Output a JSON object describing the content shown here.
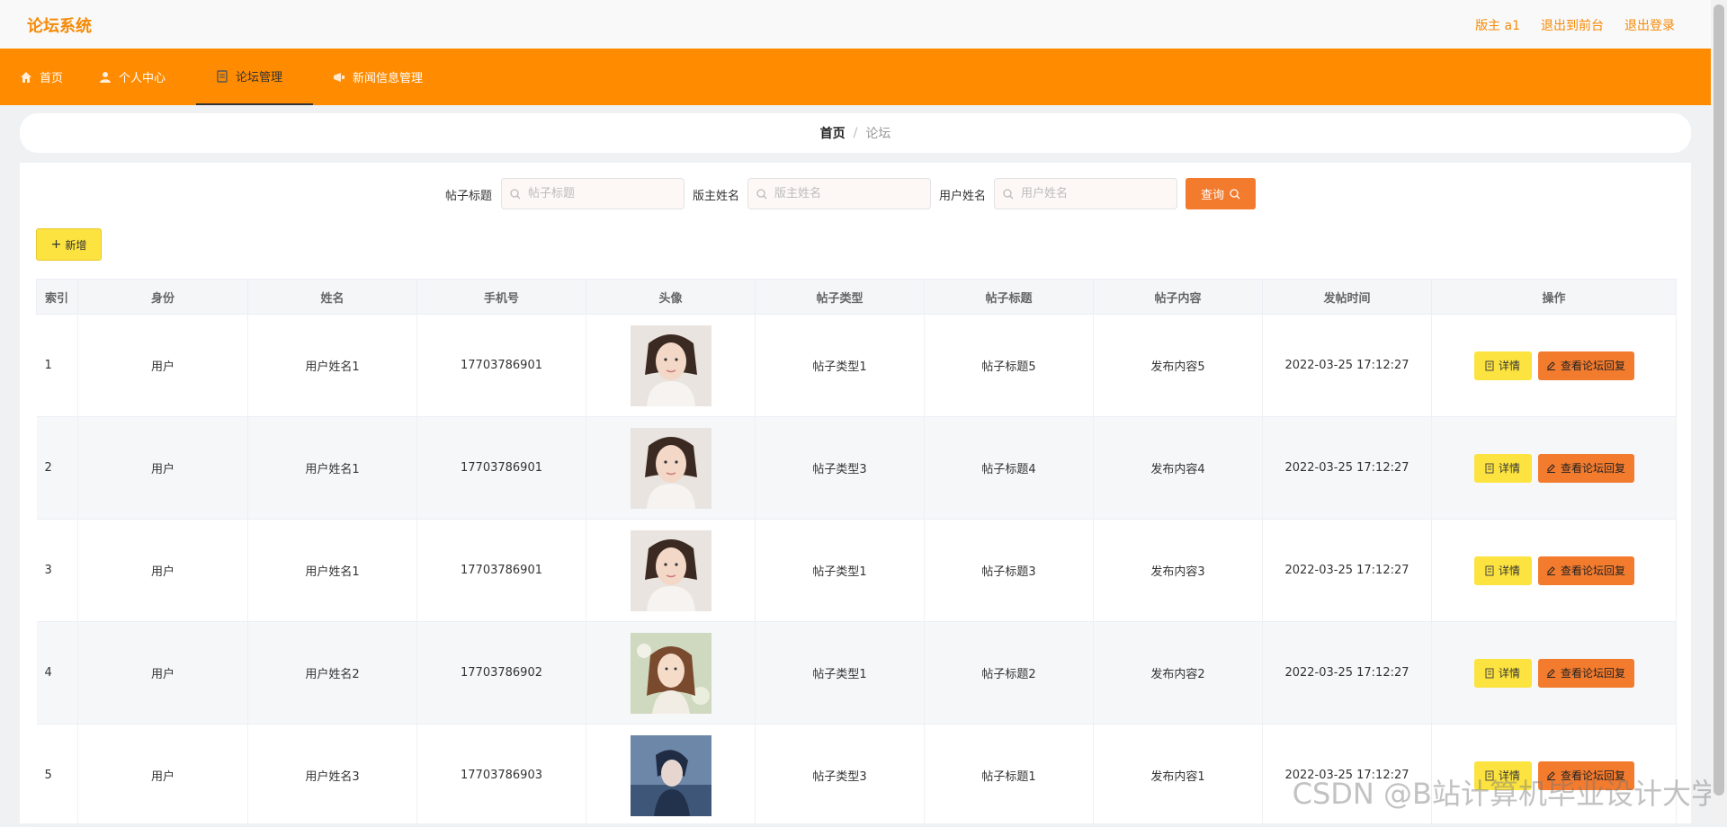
{
  "app": {
    "title": "论坛系统"
  },
  "top_links": {
    "role": "版主 a1",
    "front": "退出到前台",
    "logout": "退出登录"
  },
  "nav": [
    {
      "label": "首页",
      "icon": "home-icon"
    },
    {
      "label": "个人中心",
      "icon": "user-icon"
    },
    {
      "label": "论坛管理",
      "icon": "forum-icon",
      "active": true
    },
    {
      "label": "新闻信息管理",
      "icon": "news-icon"
    }
  ],
  "breadcrumb": {
    "home": "首页",
    "sep": "/",
    "current": "论坛"
  },
  "search": {
    "title_label": "帖子标题",
    "title_placeholder": "帖子标题",
    "owner_label": "版主姓名",
    "owner_placeholder": "版主姓名",
    "user_label": "用户姓名",
    "user_placeholder": "用户姓名",
    "query_label": "查询"
  },
  "toolbar": {
    "add_label": "新增"
  },
  "table": {
    "headers": [
      "索引",
      "身份",
      "姓名",
      "手机号",
      "头像",
      "帖子类型",
      "帖子标题",
      "帖子内容",
      "发帖时间",
      "操作"
    ],
    "rows": [
      {
        "index": "1",
        "identity": "用户",
        "name": "用户姓名1",
        "phone": "17703786901",
        "avatar": "woman-portrait-a",
        "type": "帖子类型1",
        "title": "帖子标题5",
        "content": "发布内容5",
        "time": "2022-03-25 17:12:27"
      },
      {
        "index": "2",
        "identity": "用户",
        "name": "用户姓名1",
        "phone": "17703786901",
        "avatar": "woman-portrait-a",
        "type": "帖子类型3",
        "title": "帖子标题4",
        "content": "发布内容4",
        "time": "2022-03-25 17:12:27"
      },
      {
        "index": "3",
        "identity": "用户",
        "name": "用户姓名1",
        "phone": "17703786901",
        "avatar": "woman-portrait-a",
        "type": "帖子类型1",
        "title": "帖子标题3",
        "content": "发布内容3",
        "time": "2022-03-25 17:12:27"
      },
      {
        "index": "4",
        "identity": "用户",
        "name": "用户姓名2",
        "phone": "17703786902",
        "avatar": "woman-portrait-b",
        "type": "帖子类型1",
        "title": "帖子标题2",
        "content": "发布内容2",
        "time": "2022-03-25 17:12:27"
      },
      {
        "index": "5",
        "identity": "用户",
        "name": "用户姓名3",
        "phone": "17703786903",
        "avatar": "man-portrait-blue",
        "type": "帖子类型3",
        "title": "帖子标题1",
        "content": "发布内容1",
        "time": "2022-03-25 17:12:27"
      }
    ],
    "detail_label": "详情",
    "reply_label": "查看论坛回复"
  },
  "colors": {
    "accent": "#ff8b00",
    "brand": "#f58a07",
    "query": "#f37b2e",
    "add": "#fce33f"
  },
  "watermark": "CSDN @B站计算机毕业设计大学"
}
